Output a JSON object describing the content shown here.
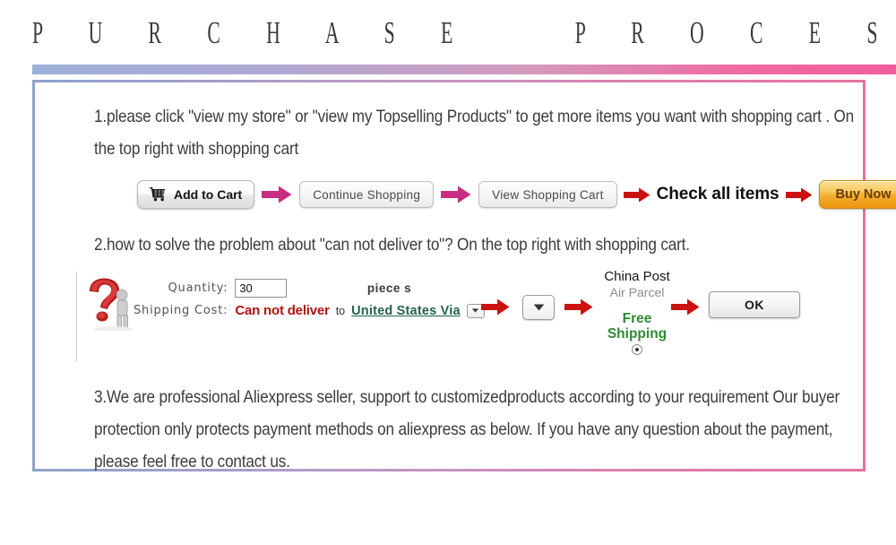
{
  "page": {
    "title": "P U R C H A S E    P R O C E S S",
    "accent_blue": "#8ea2cb",
    "accent_pink": "#e2739f"
  },
  "sections": {
    "step1": {
      "text": "1.please click \"view my store\" or \"view my Topselling Products\" to get more items you want with shopping cart . On the top right with shopping cart"
    },
    "step2": {
      "text": "2.how to solve the problem about \"can not deliver to\"?  On the top right with shopping cart."
    },
    "step3": {
      "text": "3.We are professional Aliexpress seller, support to customizedproducts according to your requirement   Our buyer protection only protects payment methods on aliexpress as below. If you have any question   about the payment, please feel free to contact us."
    }
  },
  "cart_flow": {
    "add_to_cart": "Add to Cart",
    "continue_shopping": "Continue Shopping",
    "view_shopping_cart": "View Shopping Cart",
    "check_all_items": "Check all items",
    "buy_now": "Buy Now",
    "arrow_pink_color": "#c72d80",
    "arrow_red_color": "#cc1111",
    "buy_now_color": "#f3ae2c"
  },
  "shipping_form": {
    "quantity_label": "Quantity:",
    "quantity_value": "30",
    "quantity_unit": "piece s",
    "shipping_cost_label": "Shipping Cost:",
    "cannot_deliver": "Can not deliver",
    "to_word": "to",
    "country": "United States Via",
    "carrier_name": "China Post",
    "carrier_sub": "Air Parcel",
    "free_shipping_line1": "Free",
    "free_shipping_line2": "Shipping",
    "ok_button": "OK",
    "free_shipping_color": "#2e8b33",
    "cannot_deliver_color": "#b01212"
  }
}
